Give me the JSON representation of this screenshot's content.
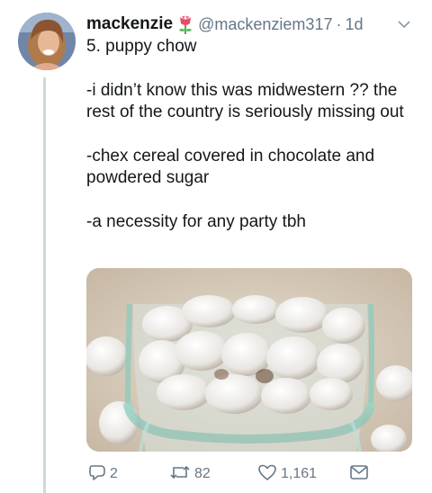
{
  "tweet": {
    "display_name": "mackenzie",
    "name_emoji": "rose-emoji",
    "handle": "@mackenziem317",
    "separator": "·",
    "time": "1d",
    "paragraphs": [
      "5. puppy chow",
      "-i didn’t know this was midwestern ?? the rest of the country is seriously missing out",
      "-chex cereal covered in chocolate and powdered sugar",
      "-a necessity for any party tbh"
    ],
    "media_icon": "puppy-chow-photo",
    "actions": {
      "reply_count": "2",
      "retweet_count": "82",
      "like_count": "1,161"
    }
  },
  "icons": {
    "reply": "reply-icon",
    "retweet": "retweet-icon",
    "like": "heart-icon",
    "dm": "envelope-icon",
    "caret": "chevron-down-icon"
  },
  "colors": {
    "text": "#14171a",
    "muted": "#657786",
    "thread_line": "#cfd9de"
  }
}
